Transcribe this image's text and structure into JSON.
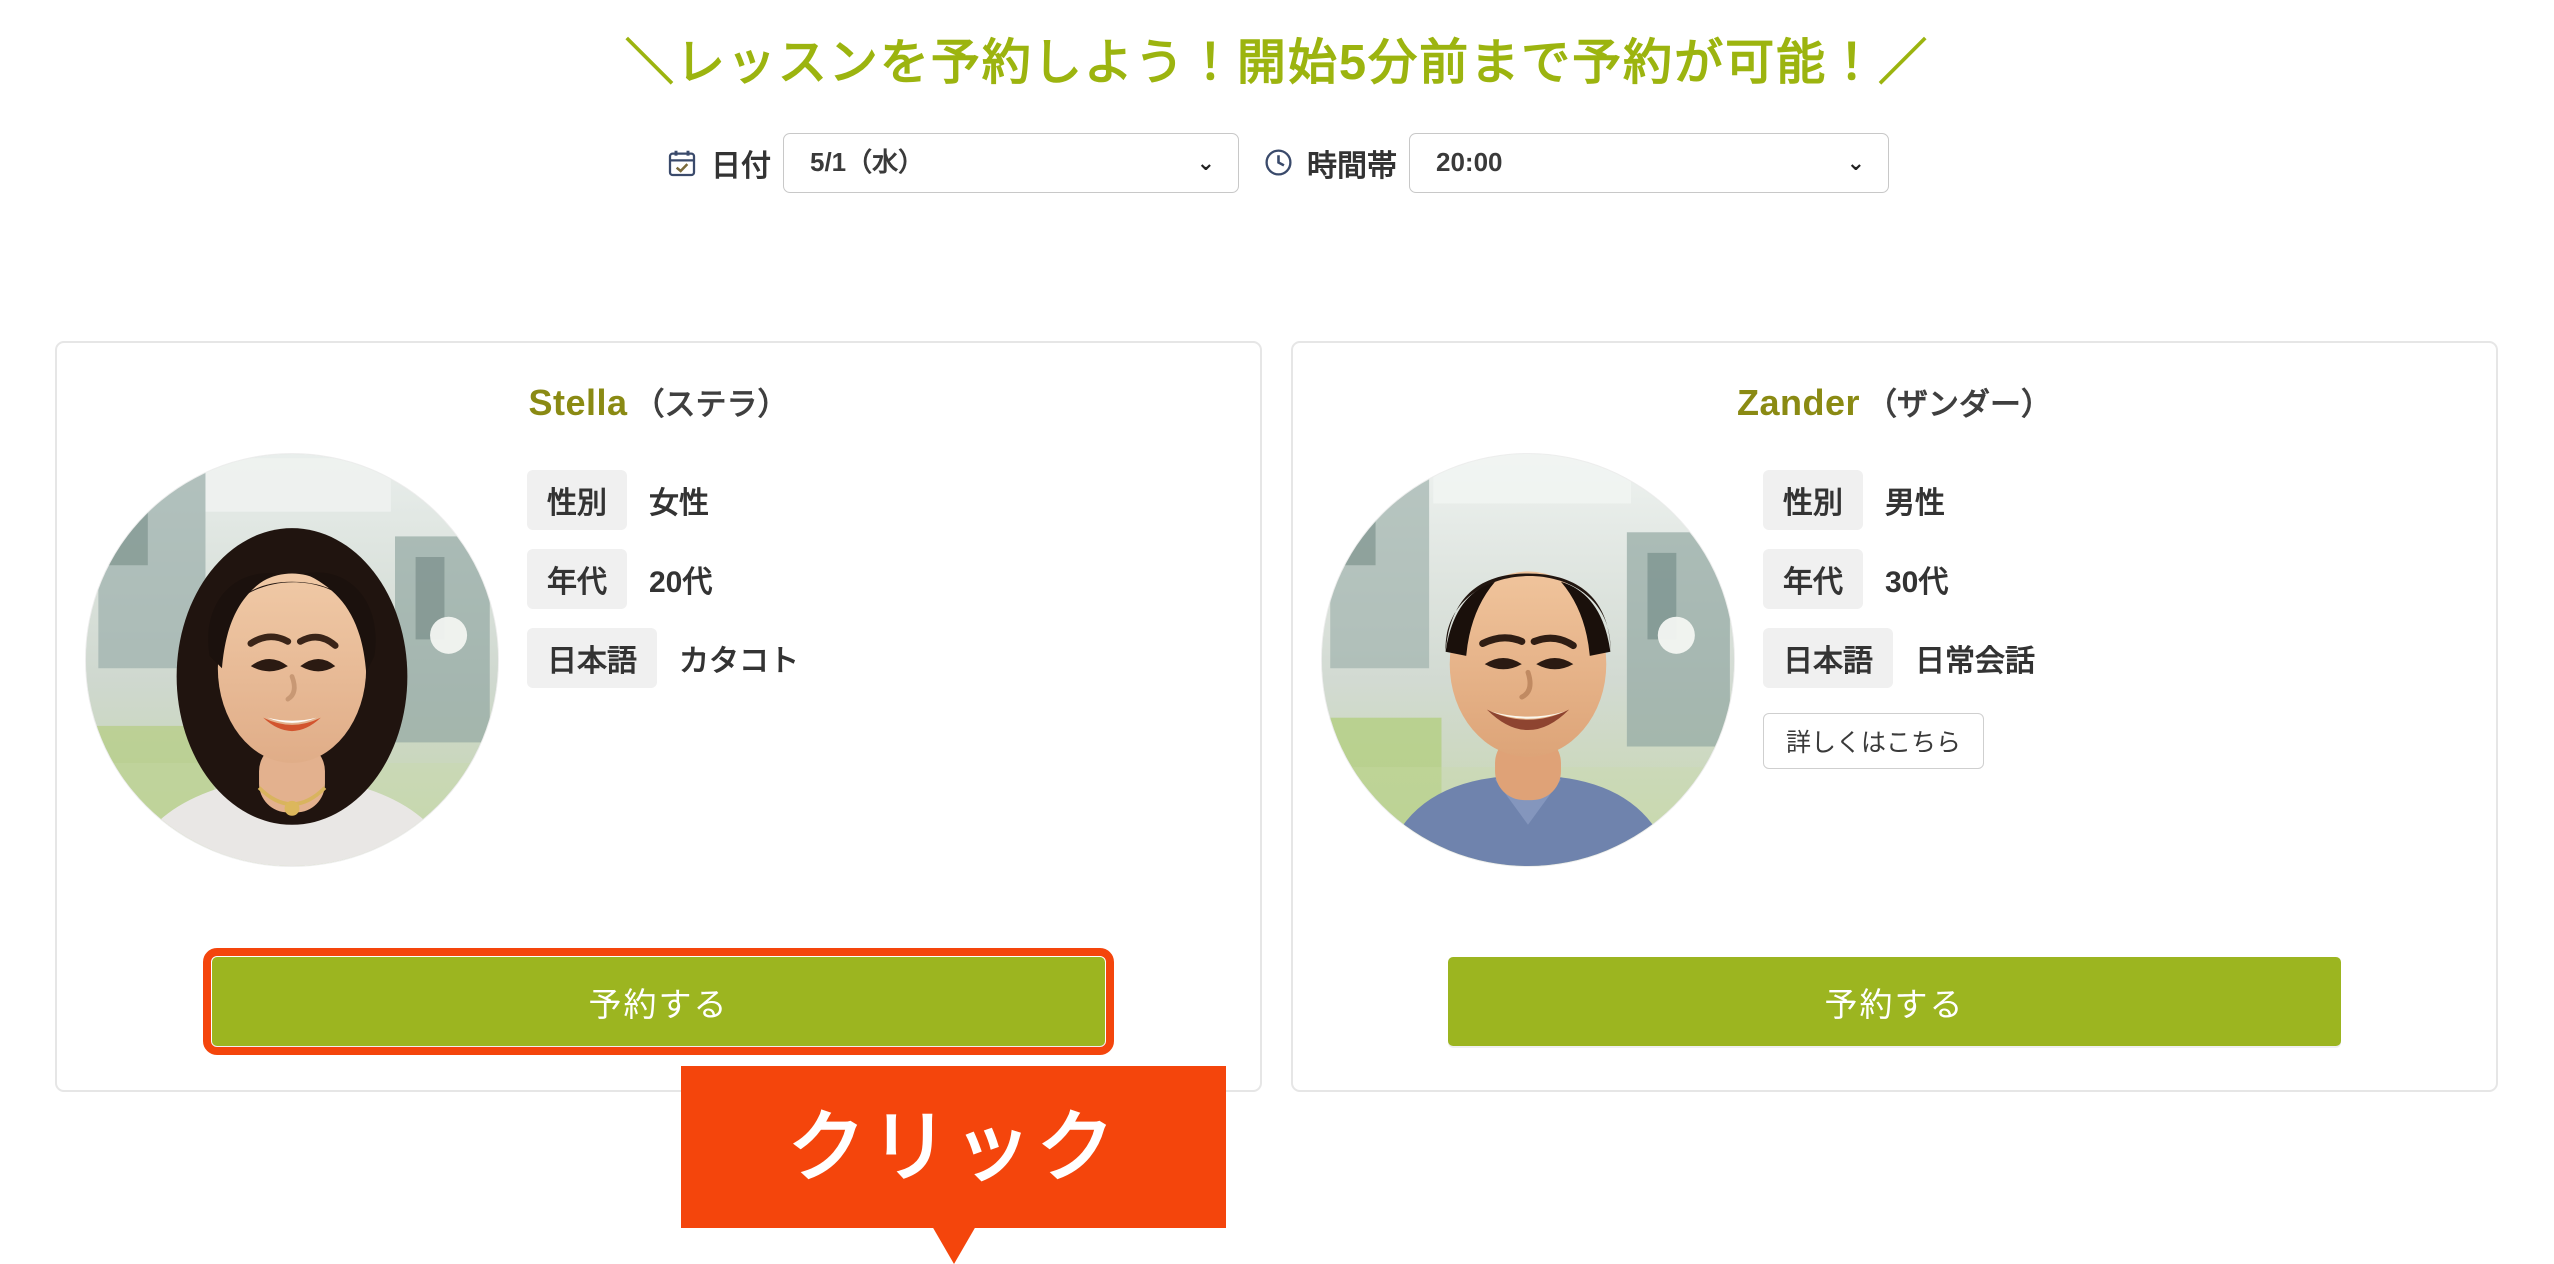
{
  "heading": "＼レッスンを予約しよう！開始5分前まで予約が可能！／",
  "filters": {
    "date": {
      "icon": "calendar-check-icon",
      "label": "日付",
      "value": "5/1（水）",
      "options": [
        "5/1（水）"
      ],
      "caret": "⌄"
    },
    "time": {
      "icon": "clock-icon",
      "label": "時間帯",
      "value": "20:00",
      "options": [
        "20:00"
      ],
      "caret": "⌄"
    }
  },
  "cards": [
    {
      "name_en": "Stella",
      "name_jp": "（ステラ）",
      "avatar_alt": "Stella profile photo",
      "attributes": [
        {
          "key": "性別",
          "value": "女性"
        },
        {
          "key": "年代",
          "value": "20代"
        },
        {
          "key": "日本語",
          "value": "カタコト"
        }
      ],
      "detail_label": null,
      "reserve_label": "予約する",
      "highlighted": true
    },
    {
      "name_en": "Zander",
      "name_jp": "（ザンダー）",
      "avatar_alt": "Zander profile photo",
      "attributes": [
        {
          "key": "性別",
          "value": "男性"
        },
        {
          "key": "年代",
          "value": "30代"
        },
        {
          "key": "日本語",
          "value": "日常会話"
        }
      ],
      "detail_label": "詳しくはこちら",
      "reserve_label": "予約する",
      "highlighted": false
    }
  ],
  "annotation": {
    "callout_text": "クリック",
    "callout_color": "#f4450c"
  },
  "colors": {
    "heading_green": "#9cb40f",
    "button_green": "#9cb520",
    "annotation_orange": "#f4450c",
    "name_olive": "#8a8a13",
    "tag_gray": "#f0f0f0",
    "card_border": "#e6e6e6"
  }
}
